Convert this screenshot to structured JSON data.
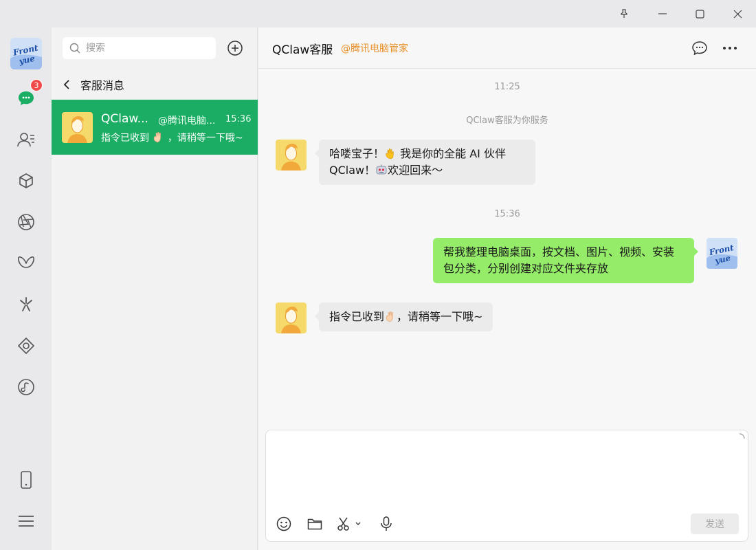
{
  "window": {
    "pin_icon": "pin-icon",
    "minimize_icon": "minimize-icon",
    "maximize_icon": "maximize-icon",
    "close_icon": "close-icon"
  },
  "rail": {
    "user_avatar": "Front Yue",
    "chat_badge": "3",
    "items": [
      "chat-icon",
      "contacts-icon",
      "cube-icon",
      "aperture-icon",
      "butterfly-icon",
      "sparkle-icon",
      "diamond-icon",
      "music-icon"
    ],
    "bottom": [
      "phone-icon",
      "menu-icon"
    ]
  },
  "list": {
    "search_placeholder": "搜索",
    "back_label": "客服消息",
    "conversations": [
      {
        "name": "QClaw...",
        "tag": "@腾讯电脑...",
        "time": "15:36",
        "preview": "指令已收到",
        "preview_tail": "，请稍等一下哦~"
      }
    ]
  },
  "chat": {
    "title": "QClaw客服",
    "subtitle": "@腾讯电脑管家",
    "time1": "11:25",
    "system_msg": "QClaw客服为你服务",
    "msg1_part1": "哈喽宝子！",
    "msg1_part2": " 我是你的全能 AI 伙伴",
    "msg1_part3": "QClaw！",
    "msg1_part4": "欢迎回来～",
    "time2": "15:36",
    "msg2": "帮我整理电脑桌面，按文档、图片、视频、安装包分类，分别创建对应文件夹存放",
    "msg3_part1": "指令已收到",
    "msg3_part2": "，请稍等一下哦~",
    "send_label": "发送"
  },
  "colors": {
    "accent": "#1aad63",
    "bubble_out": "#95ec69",
    "badge": "#f24a4a",
    "subtitle": "#e8902a"
  }
}
